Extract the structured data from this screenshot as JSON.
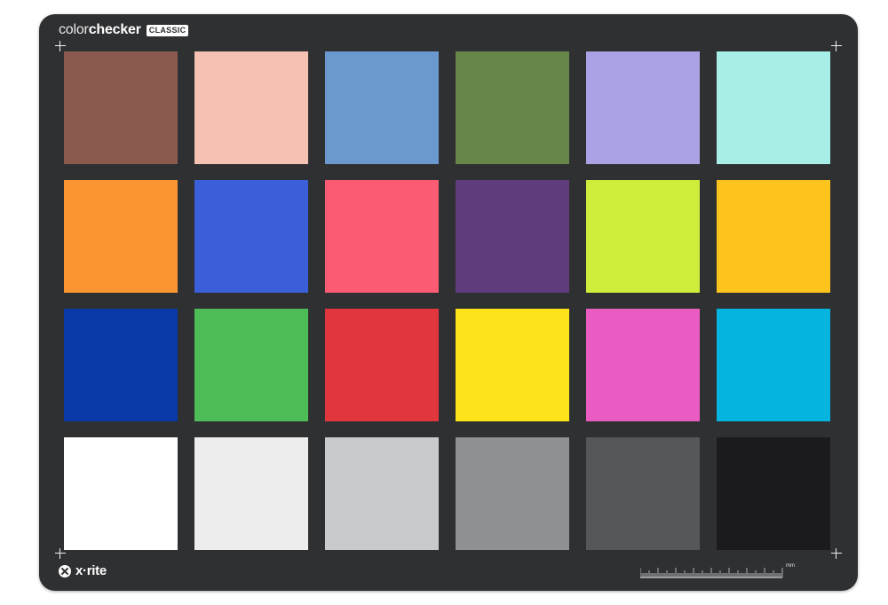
{
  "brand": {
    "name_light": "color",
    "name_bold": "checker",
    "badge": "CLASSIC"
  },
  "logo": {
    "text": "x·rite",
    "icon": "x-rite-icon"
  },
  "ruler": {
    "unit": "mm"
  },
  "colors": {
    "board": "#2f3032",
    "patches": [
      [
        "#8b5a4f",
        "#f5c1b2",
        "#6b98cf",
        "#67874a",
        "#a9a3e5",
        "#a6eee6"
      ],
      [
        "#fb9532",
        "#3a5fd9",
        "#fb5b73",
        "#603c7c",
        "#cfee3b",
        "#fdc41e"
      ],
      [
        "#0939a7",
        "#4fbd57",
        "#e2363e",
        "#fde41a",
        "#eb5cc3",
        "#06b4e0"
      ],
      [
        "#ffffff",
        "#ededee",
        "#c8cacb",
        "#8f9094",
        "#55575b",
        "#1b1b1d"
      ]
    ]
  }
}
